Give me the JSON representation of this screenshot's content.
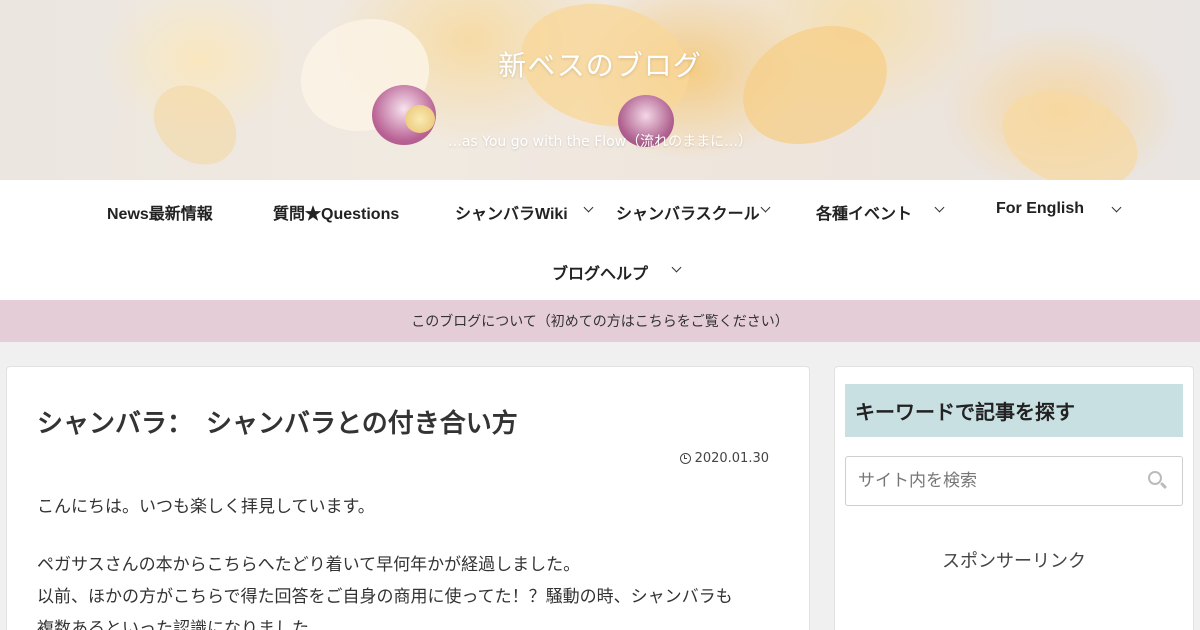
{
  "site": {
    "title": "新ベスのブログ",
    "tagline": "…as You go with the Flow（流れのままに…）"
  },
  "nav": {
    "items": [
      {
        "label": "News最新情報",
        "has_dropdown": false
      },
      {
        "label": "質問★Questions",
        "has_dropdown": false
      },
      {
        "label": "シャンバラWiki",
        "has_dropdown": true
      },
      {
        "label": "シャンバラスクール",
        "has_dropdown": true
      },
      {
        "label": "各種イベント",
        "has_dropdown": true
      },
      {
        "label": "For English",
        "has_dropdown": true
      },
      {
        "label": "ブログヘルプ",
        "has_dropdown": true
      }
    ]
  },
  "notice": {
    "text": "このブログについて（初めての方はこちらをご覧ください）"
  },
  "article": {
    "title": "シャンバラ：　シャンバラとの付き合い方",
    "date": "2020.01.30",
    "paragraphs": [
      "こんにちは。いつも楽しく拝見しています。",
      "ペガサスさんの本からこちらへたどり着いて早何年かが経過しました。",
      "以前、ほかの方がこちらで得た回答をご自身の商用に使ってた！？騒動の時、シャンバラも",
      "複数あるといった認識になりました。"
    ]
  },
  "sidebar": {
    "search_widget_title": "キーワードで記事を探す",
    "search_placeholder": "サイト内を検索",
    "search_value": "",
    "sponsor_label": "スポンサーリンク"
  },
  "colors": {
    "notice_bg": "#e4cdd7",
    "widget_title_bg": "#c9e0e2",
    "page_bg": "#f0f0f0"
  },
  "icons": {
    "date": "clock-icon",
    "search": "search-icon",
    "dropdown": "chevron-down-icon"
  }
}
